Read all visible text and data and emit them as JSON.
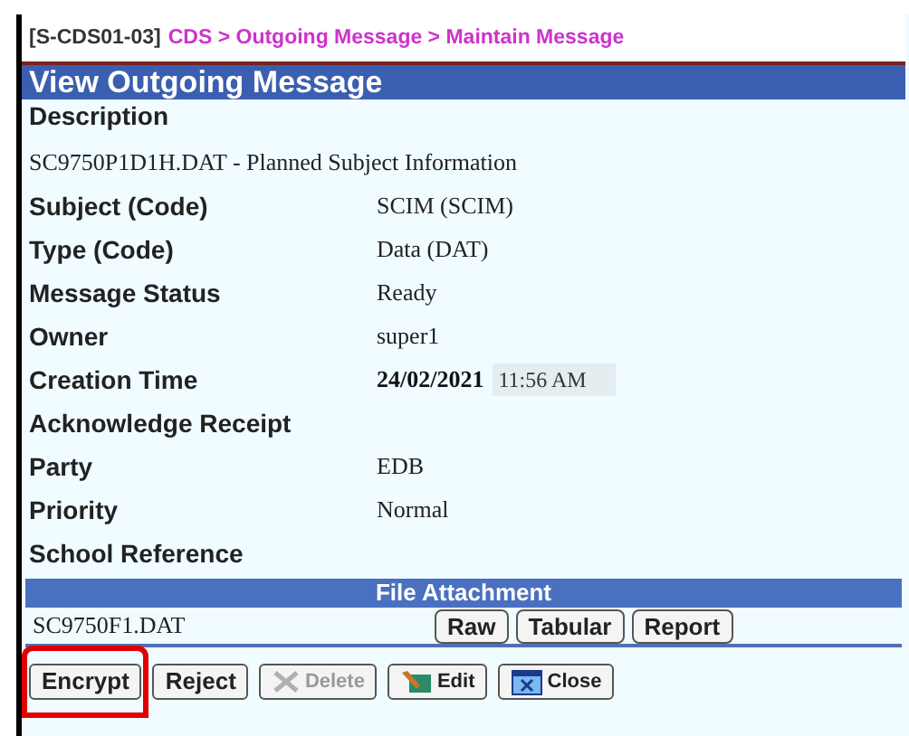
{
  "breadcrumb": {
    "code": "[S-CDS01-03]",
    "path": "CDS > Outgoing Message > Maintain Message"
  },
  "title": "View Outgoing Message",
  "description": {
    "label": "Description",
    "value": "SC9750P1D1H.DAT - Planned Subject Information"
  },
  "fields": [
    {
      "label": "Subject (Code)",
      "value": "SCIM (SCIM)"
    },
    {
      "label": "Type (Code)",
      "value": "Data (DAT)"
    },
    {
      "label": "Message Status",
      "value": "Ready"
    },
    {
      "label": "Owner",
      "value": "super1"
    },
    {
      "label": "Creation Time",
      "date": "24/02/2021",
      "time": "11:56 AM"
    },
    {
      "label": "Acknowledge Receipt"
    },
    {
      "label": "Party",
      "value": "EDB"
    },
    {
      "label": "Priority",
      "value": "Normal"
    },
    {
      "label": "School Reference"
    }
  ],
  "attachment": {
    "header": "File Attachment",
    "file": "SC9750F1.DAT",
    "buttons": [
      "Raw",
      "Tabular",
      "Report"
    ]
  },
  "actions": [
    {
      "label": "Encrypt",
      "kind": "plain",
      "disabled": false,
      "highlighted": true
    },
    {
      "label": "Reject",
      "kind": "plain",
      "disabled": false,
      "highlighted": false
    },
    {
      "label": "Delete",
      "kind": "delete",
      "disabled": true,
      "highlighted": false
    },
    {
      "label": "Edit",
      "kind": "edit",
      "disabled": false,
      "highlighted": false
    },
    {
      "label": "Close",
      "kind": "close",
      "disabled": false,
      "highlighted": false
    }
  ]
}
